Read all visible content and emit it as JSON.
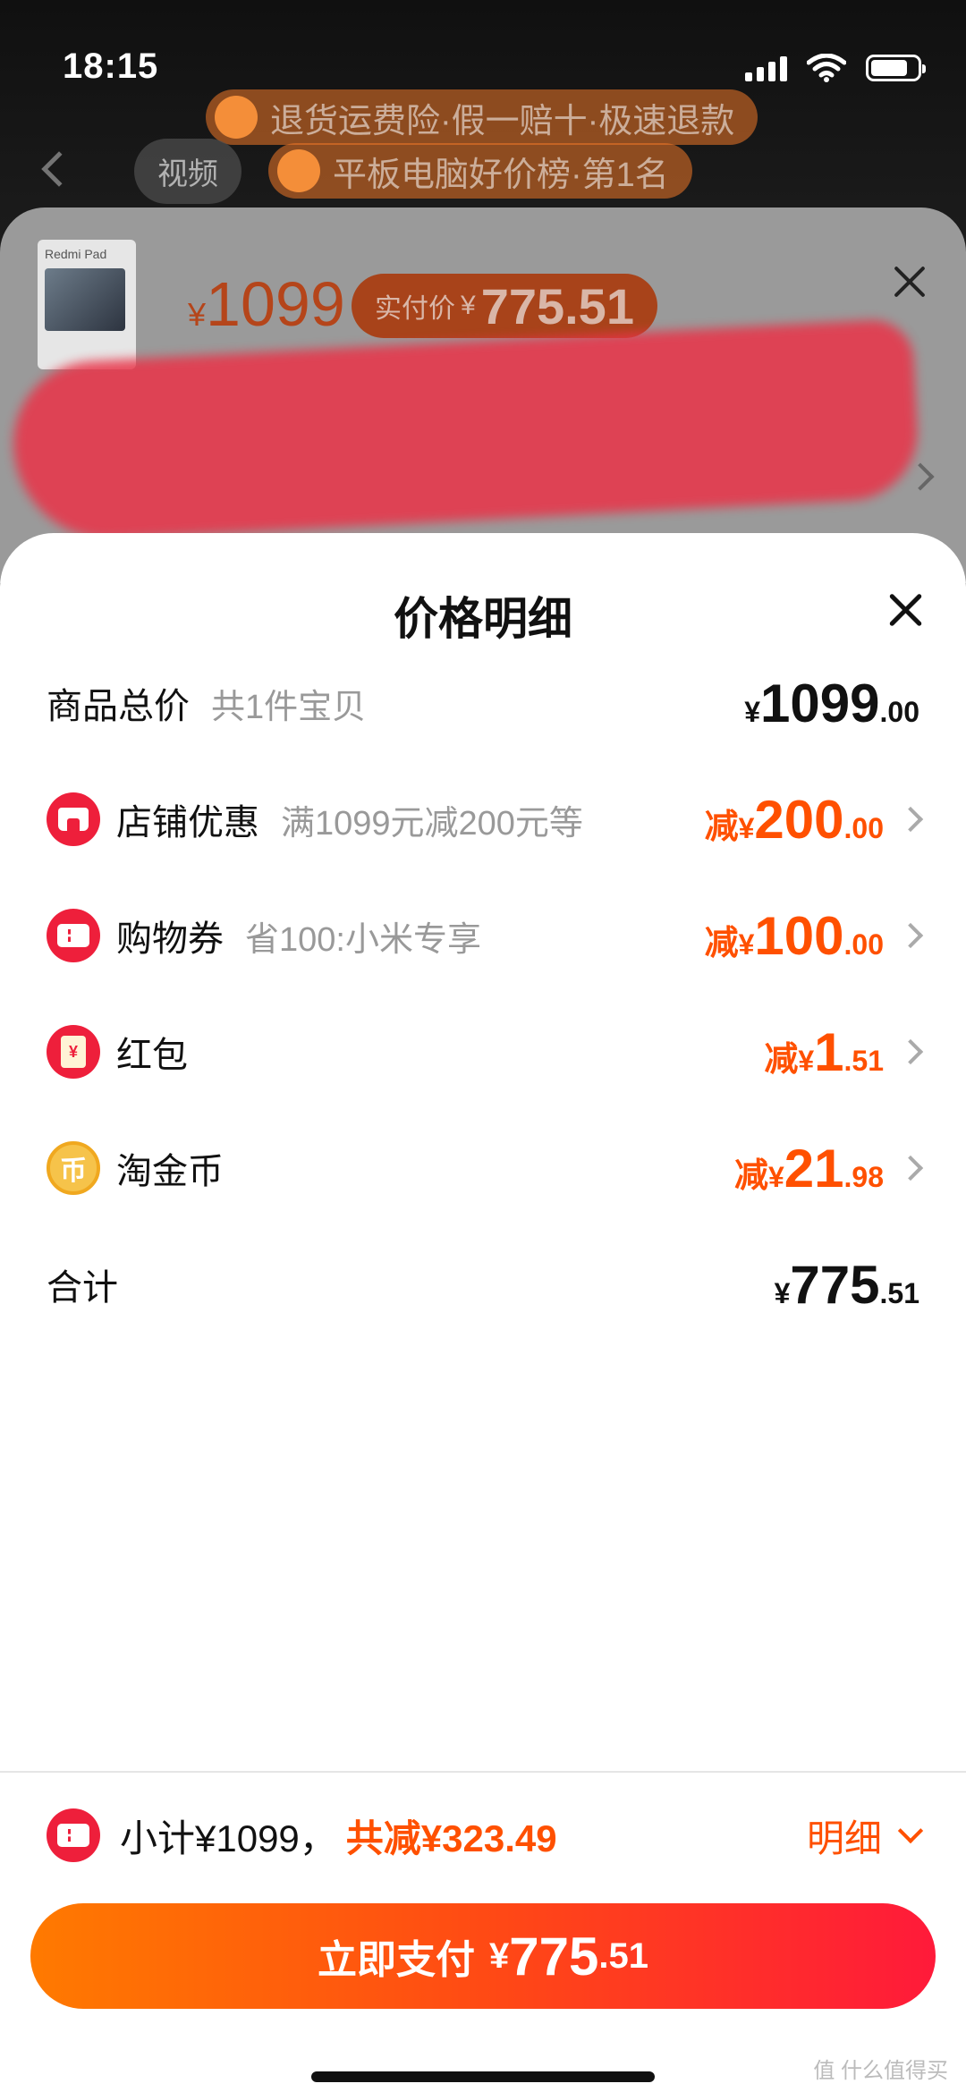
{
  "status_bar": {
    "time": "18:15"
  },
  "background": {
    "promo_1": "退货运费险·假一赔十·极速退款",
    "promo_2": "平板电脑好价榜·第1名",
    "tab_video": "视频"
  },
  "product_sheet": {
    "thumbnail_text": "Redmi Pad",
    "price_yen": "¥",
    "price": "1099",
    "actual_label": "实付价",
    "actual_yen": "¥",
    "actual_price": "775.51"
  },
  "price_detail": {
    "title": "价格明细",
    "rows": [
      {
        "label": "商品总价",
        "sub": "共1件宝贝",
        "prefix": "",
        "yen": "¥",
        "int": "1099",
        "dec": ".00",
        "icon": ""
      },
      {
        "label": "店铺优惠",
        "sub": "满1099元减200元等",
        "prefix": "减",
        "yen": "¥",
        "int": "200",
        "dec": ".00",
        "icon": "shop-icon"
      },
      {
        "label": "购物券",
        "sub": "省100:小米专享",
        "prefix": "减",
        "yen": "¥",
        "int": "100",
        "dec": ".00",
        "icon": "coupon-icon"
      },
      {
        "label": "红包",
        "sub": "",
        "prefix": "减",
        "yen": "¥",
        "int": "1",
        "dec": ".51",
        "icon": "red-envelope-icon",
        "envelope_glyph": "¥"
      },
      {
        "label": "淘金币",
        "sub": "",
        "prefix": "减",
        "yen": "¥",
        "int": "21",
        "dec": ".98",
        "icon": "coin-icon",
        "coin_glyph": "币"
      },
      {
        "label": "合计",
        "sub": "",
        "prefix": "",
        "yen": "¥",
        "int": "775",
        "dec": ".51",
        "icon": ""
      }
    ]
  },
  "bottom_bar": {
    "subtotal": "小计¥1099，",
    "saved": "共减¥323.49",
    "detail_label": "明细",
    "pay_label": "立即支付",
    "pay_yen": "¥",
    "pay_int": "775",
    "pay_dec": ".51"
  },
  "watermark": "值 什么值得买",
  "colors": {
    "accent": "#ff5000",
    "red": "#ee1f3b",
    "button_start": "#ff7a00",
    "button_end": "#ff1a3a"
  }
}
